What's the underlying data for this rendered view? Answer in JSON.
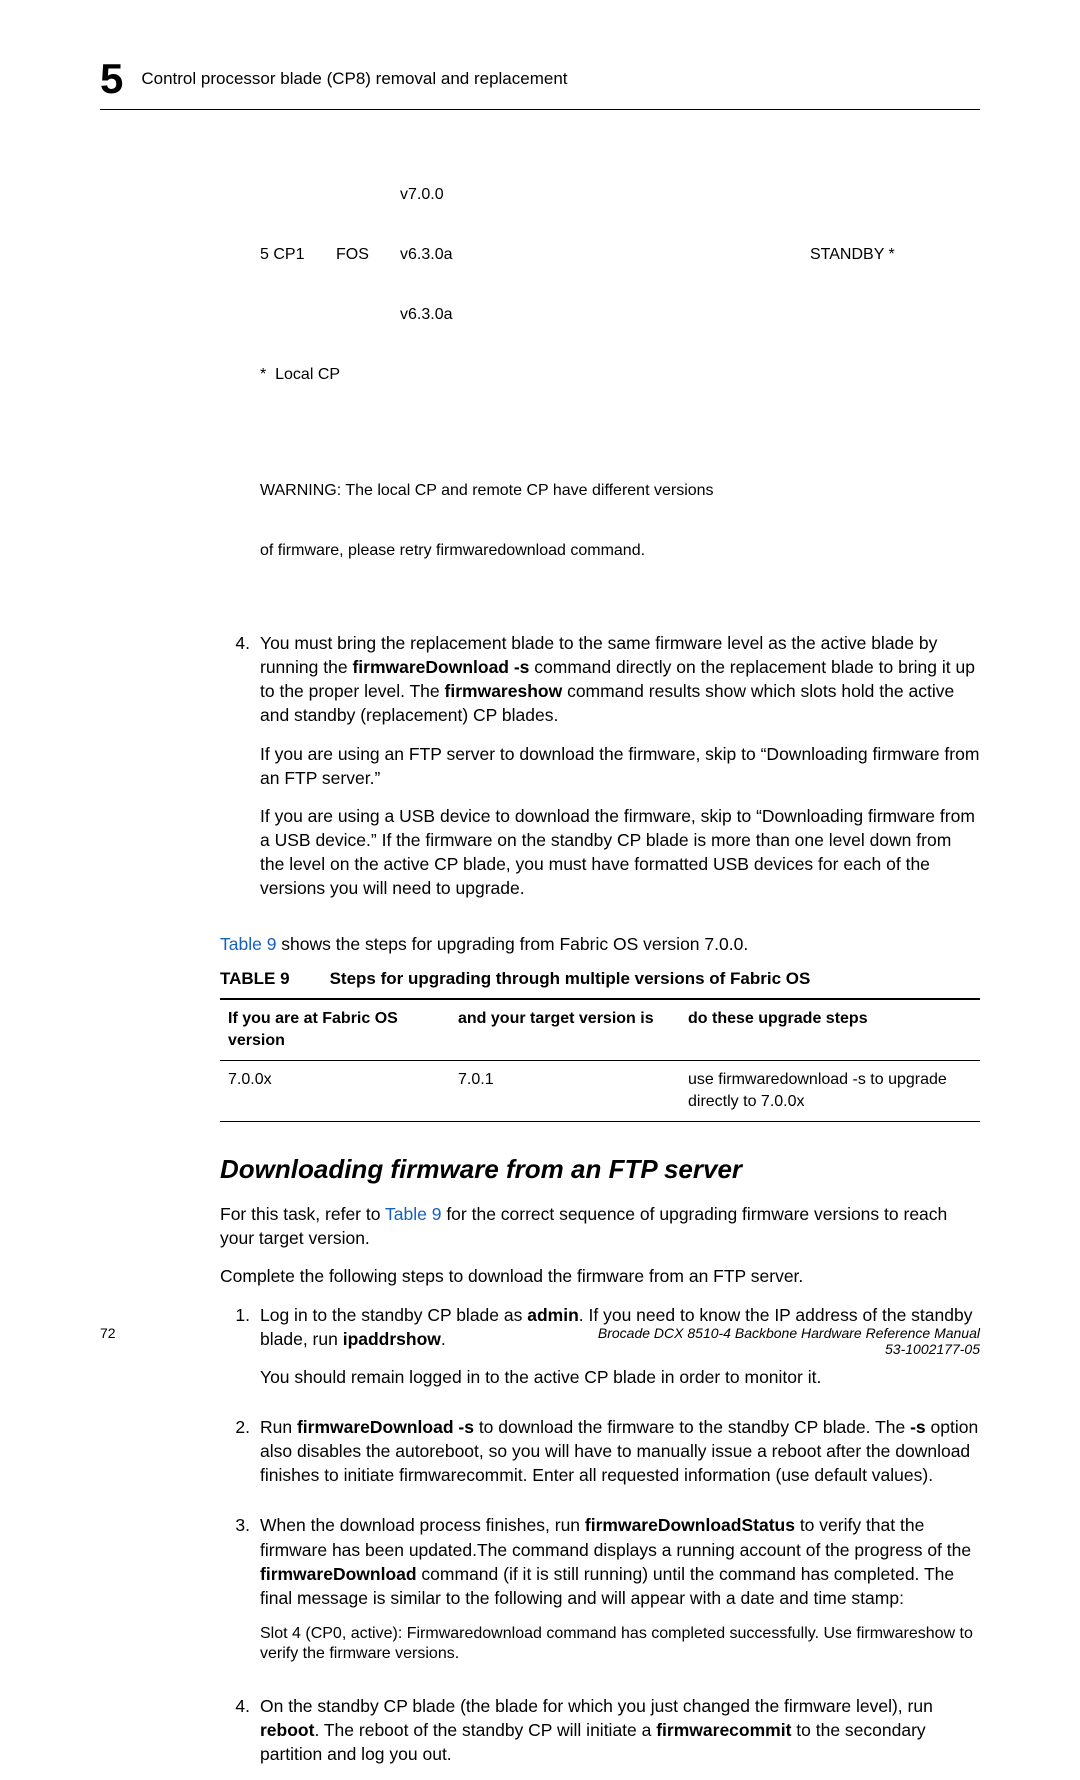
{
  "header": {
    "chapter_num": "5",
    "title": "Control processor blade (CP8) removal and replacement"
  },
  "code": {
    "l1_ver": "v7.0.0",
    "l2_slot": "5 CP1",
    "l2_os": "FOS",
    "l2_ver": "v6.3.0a",
    "l2_status": "STANDBY *",
    "l3_ver": "v6.3.0a",
    "l4": "*  Local CP",
    "warn1": "WARNING: The local CP and remote CP have different versions",
    "warn2": "of firmware, please retry firmwaredownload command."
  },
  "step4": {
    "num": "4.",
    "p1a": "You must bring the replacement blade to the same firmware level as the active blade by running the ",
    "p1b": "firmwareDownload -s",
    "p1c": " command directly on the replacement blade to bring it up to the proper level. The ",
    "p1d": "firmwareshow",
    "p1e": " command results show which slots hold the active and standby (replacement) CP blades.",
    "p2": "If you are using an FTP server to download the firmware, skip to “Downloading firmware from an FTP server.”",
    "p3": "If you are using a USB device to download the firmware, skip to “Downloading firmware from a USB device.” If the firmware on the standby CP blade is more than one level down from the level on the active CP blade, you must have formatted USB devices for each of the versions you will need to upgrade."
  },
  "tableintro": {
    "link": "Table 9",
    "rest": " shows the steps for upgrading from Fabric OS version 7.0.0."
  },
  "table": {
    "label": "TABLE 9",
    "caption": "Steps for upgrading through multiple versions of Fabric OS",
    "h1": "If you are at Fabric OS version",
    "h2": "and your target version is",
    "h3": "do these upgrade steps",
    "r1c1": "7.0.0x",
    "r1c2": "7.0.1",
    "r1c3": "use firmwaredownload -s to upgrade directly to 7.0.0x"
  },
  "section": {
    "h2": "Downloading firmware from an FTP server",
    "p1a": "For this task, refer to ",
    "p1link": "Table 9",
    "p1b": " for the correct sequence of upgrading firmware versions to reach your target version.",
    "p2": "Complete the following steps to download the firmware from an FTP server.",
    "s1": {
      "num": "1.",
      "t1": "Log in to the standby CP blade as ",
      "t2": "admin",
      "t3": ". If you need to know the IP address of the standby blade, run ",
      "t4": "ipaddrshow",
      "t5": ".",
      "sub": "You should remain logged in to the active CP blade in order to monitor it."
    },
    "s2": {
      "num": "2.",
      "t1": "Run ",
      "t2": "firmwareDownload -s",
      "t3": " to download the firmware to the standby CP blade. The ",
      "t4": "-s",
      "t5": " option also disables the autoreboot, so you will have to manually issue a reboot after the download finishes to initiate firmwarecommit. Enter all requested information (use default values)."
    },
    "s3": {
      "num": "3.",
      "t1": "When the download process finishes, run ",
      "t2": "firmwareDownloadStatus",
      "t3": " to verify that the firmware has been updated.The command displays a running account of the progress of the ",
      "t4": "firmwareDownload",
      "t5": " command (if it is still running) until the command has completed. The final message is similar to the following and will appear with a date and time stamp:",
      "msg1": "Slot 4 (CP0, active): Firmwaredownload command has completed successfully. Use firmwareshow to verify the firmware versions."
    },
    "s4": {
      "num": "4.",
      "t1": "On the standby CP blade (the blade for which you just changed the firmware level), run ",
      "t2": "reboot",
      "t3": ". The reboot of the standby CP will initiate a ",
      "t4": "firmwarecommit",
      "t5": " to the secondary partition and log you out."
    }
  },
  "footer": {
    "page": "72",
    "doc_title": "Brocade DCX 8510-4 Backbone Hardware Reference Manual",
    "doc_num": "53-1002177-05"
  }
}
